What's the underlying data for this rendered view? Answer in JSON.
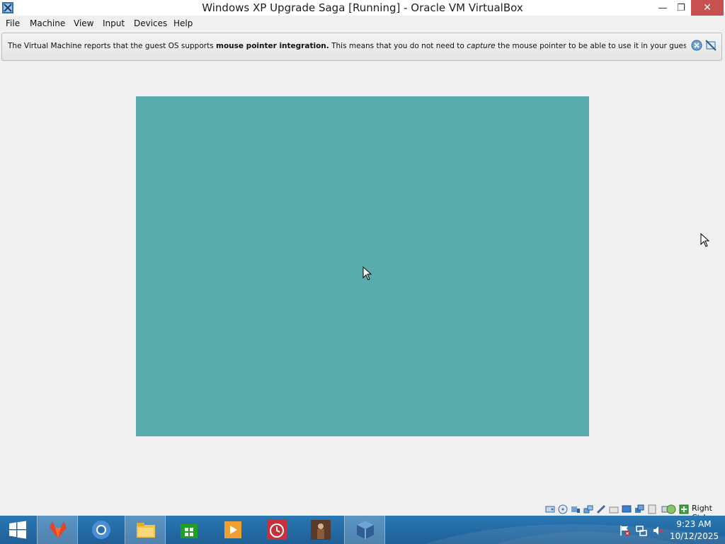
{
  "window": {
    "title": "Windows XP Upgrade Saga [Running] - Oracle VM VirtualBox",
    "min_glyph": "—",
    "max_glyph": "❐",
    "close_glyph": "✕"
  },
  "menu": {
    "items": [
      "File",
      "Machine",
      "View",
      "Input",
      "Devices",
      "Help"
    ]
  },
  "notice": {
    "text_before": "The Virtual Machine reports that the guest OS supports ",
    "bold": "mouse pointer integration.",
    "text_middle": " This means that you do not need to ",
    "italic": "capture",
    "text_after": " the mouse pointer to be able to use it in your guest OS -- all mouse",
    "icons": [
      "close-notice-icon",
      "do-not-show-again-icon"
    ]
  },
  "vm": {
    "screen_color": "#5aabab"
  },
  "statusbar": {
    "host_key": "Right Ctrl",
    "icons": [
      "hard-disk-icon",
      "optical-drive-icon",
      "audio-icon",
      "network-icon",
      "usb-icon",
      "shared-folders-icon",
      "display-icon",
      "video-capture-icon",
      "graphics-icon",
      "cpu-icon",
      "mouse-integration-icon",
      "keyboard-icon"
    ]
  },
  "taskbar": {
    "apps": [
      "start-button",
      "gitlab-icon",
      "browser-icon",
      "file-explorer-icon",
      "store-icon",
      "media-player-icon",
      "alarms-icon",
      "photo-app-icon",
      "virtualbox-icon"
    ],
    "time": "9:23 AM",
    "date": "10/12/2025",
    "tray": [
      "action-center-flag-icon",
      "network-tray-icon",
      "volume-muted-icon"
    ]
  },
  "colors": {
    "taskbar": "#1f6aa5",
    "close_button": "#c75050",
    "vm_screen": "#5aabab"
  }
}
